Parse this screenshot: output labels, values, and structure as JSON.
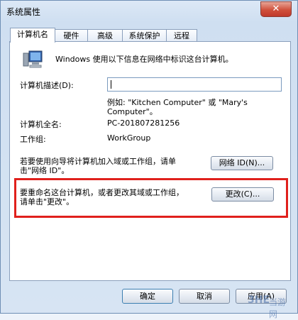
{
  "window": {
    "title": "系统属性",
    "close": "✕"
  },
  "tabs": [
    "计算机名",
    "硬件",
    "高级",
    "系统保护",
    "远程"
  ],
  "panel": {
    "intro": "Windows 使用以下信息在网络中标识这台计算机。",
    "desc_label": "计算机描述(D):",
    "desc_value": "",
    "example_line1": "例如: \"Kitchen Computer\" 或 \"Mary's",
    "example_line2": "Computer\"。",
    "fullname_label": "计算机全名:",
    "fullname_value": "PC-201807281256",
    "workgroup_label": "工作组:",
    "workgroup_value": "WorkGroup",
    "netid_text_1": "若要使用向导将计算机加入域或工作组，请单",
    "netid_text_2": "击\"网络 ID\"。",
    "netid_button": "网络 ID(N)...",
    "change_text_1": "要重命名这台计算机，或者更改其域或工作组，",
    "change_text_2": "请单击\"更改\"。",
    "change_button": "更改(C)..."
  },
  "buttons": {
    "ok": "确定",
    "cancel": "取消",
    "apply": "应用(A)"
  },
  "watermark": {
    "text": "当游网",
    "mark": "3HE"
  }
}
